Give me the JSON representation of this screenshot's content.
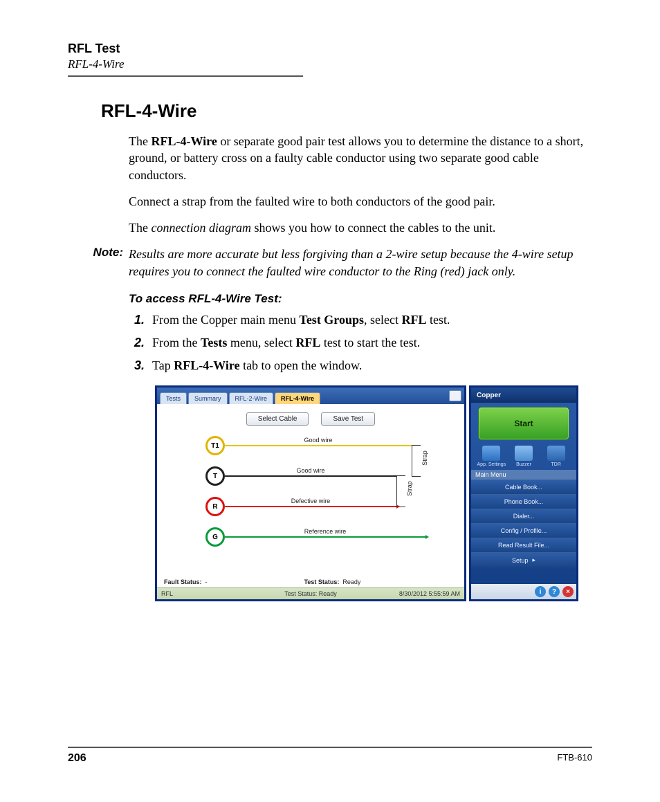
{
  "header": {
    "title": "RFL Test",
    "subtitle": "RFL-4-Wire"
  },
  "section_title": "RFL-4-Wire",
  "p1_a": "The ",
  "p1_b": "RFL-4-Wire",
  "p1_c": " or separate good pair test allows you to determine the distance to a short, ground, or battery cross on a faulty cable conductor using two separate good cable conductors.",
  "p2": "Connect a strap from the faulted wire to both conductors of the good pair.",
  "p3_a": "The ",
  "p3_b": "connection diagram",
  "p3_c": " shows you how to connect the cables to the unit.",
  "note_label": "Note:",
  "note_text": "Results are more accurate but less forgiving than a 2-wire setup because the 4-wire setup requires you to connect the faulted wire conductor to the Ring (red) jack only.",
  "proc_title": "To access RFL-4-Wire Test:",
  "steps": {
    "s1_a": "From the Copper main menu ",
    "s1_b": "Test Groups",
    "s1_c": ", select ",
    "s1_d": "RFL",
    "s1_e": " test.",
    "s2_a": "From the ",
    "s2_b": "Tests",
    "s2_c": " menu, select ",
    "s2_d": "RFL",
    "s2_e": " test to start the test.",
    "s3_a": "Tap ",
    "s3_b": "RFL-4-Wire",
    "s3_c": " tab to open the window."
  },
  "shot": {
    "tabs": [
      "Tests",
      "Summary",
      "RFL-2-Wire",
      "RFL-4-Wire"
    ],
    "buttons": {
      "select_cable": "Select Cable",
      "save_test": "Save Test"
    },
    "ports": {
      "t1": "T1",
      "t": "T",
      "r": "R",
      "g": "G"
    },
    "wires": {
      "good": "Good wire",
      "defective": "Defective wire",
      "reference": "Reference wire"
    },
    "strap": "Strap",
    "status": {
      "fault_label": "Fault Status:",
      "fault_val": "-",
      "test_label": "Test Status:",
      "test_val": "Ready"
    },
    "footer": {
      "left": "RFL",
      "center": "Test Status: Ready",
      "right": "8/30/2012 5:55:59 AM"
    },
    "side": {
      "title": "Copper",
      "start": "Start",
      "icons": [
        "App. Settings",
        "Buzzer",
        "TDR"
      ],
      "menu_header": "Main Menu",
      "menu": [
        "Cable Book...",
        "Phone Book...",
        "Dialer...",
        "Config / Profile...",
        "Read Result File...",
        "Setup"
      ]
    }
  },
  "footer": {
    "page": "206",
    "model": "FTB-610"
  }
}
